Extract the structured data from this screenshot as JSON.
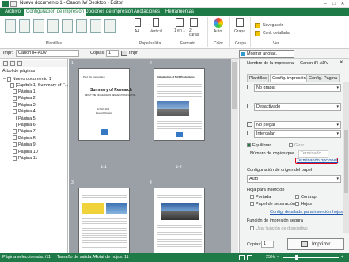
{
  "window": {
    "title": "Nuevo documento 1 - Canon iW Desktop - Editor"
  },
  "menu": {
    "tabs": [
      "Archivo",
      "Configuración de impresión",
      "Opciones de impresión",
      "Anotaciones",
      "Herramientas"
    ]
  },
  "ribbon": {
    "groups": [
      "Plantillas",
      "Papel salida",
      "Formato",
      "Color",
      "Grapa",
      "Ver"
    ],
    "items": {
      "paper": "A4",
      "orientation": "Vertical",
      "layout": "1 en 1",
      "duplex": "2 caras",
      "color": "Auto",
      "staple": "Grapa"
    },
    "view": {
      "navigation": "Navegación",
      "detailed": "Conf. detallada"
    }
  },
  "toolbar": {
    "printer_label": "Impr:",
    "printer": "Canon iR-ADV",
    "copies_label": "Copias:",
    "copies": "1",
    "print_btn": "Impr.",
    "show_annotations": "Mostrar anotac."
  },
  "tree": {
    "title": "Árbol de páginas",
    "root": "Nuevo documento 1",
    "chapter": "[Capítulo1] Summary of F...",
    "pages": [
      "Página 1",
      "Página 2",
      "Página 3",
      "Página 4",
      "Página 5",
      "Página 6",
      "Página 7",
      "Página 8",
      "Página 9",
      "Página 10",
      "Página 11"
    ]
  },
  "center": {
    "page_numbers": [
      "1",
      "2",
      "3",
      "4"
    ],
    "captions": [
      "1-1",
      "1-2"
    ],
    "thumb1": {
      "line1": "Pilot XG Corporation",
      "title": "Summary of Research",
      "sub": "ABOUT THE INFLUENCE OF RESEARCH AND CAPITAL",
      "date": "11 MAY, 2010",
      "author": "Research Division"
    },
    "thumb2": {
      "title": "Introduction of NAS Productions"
    }
  },
  "rightpane": {
    "printer_label": "Nombre de la impresora:",
    "printer": "Canon iR-ADV",
    "tabs": [
      "Plantillas",
      "Config. impresión",
      "Config. Página"
    ],
    "dropdowns": [
      "No grapar",
      "Desactivado",
      "No plegar",
      "Intercalar"
    ],
    "eco_label": "Equilibrar",
    "girar_label": "Girar",
    "copies_label": "Número de copias que",
    "copies_value": "Terminado",
    "finishing_link": "Terminando opciones",
    "origin_label": "Configuración de origen del papel",
    "origin_value": "Auto",
    "insert_label": "Hoja para inserción",
    "portada": "Portada",
    "contrap": "Contrap.",
    "papel_sep": "Papel de separación",
    "hojas": "Hojas",
    "insert_link": "Config. detallada para inserción hojas",
    "secure_label": "Función de impresión segura",
    "secure_check": "Usar función de dispositivo",
    "copies_bottom_label": "Copias:",
    "copies_bottom": "1",
    "print_button": "Imprimir"
  },
  "status": {
    "selected": "Página seleccionada: /11",
    "output": "Tamaño de salida:A4",
    "total": "Total de hojas: 11",
    "zoom": "25%"
  },
  "colors": {
    "brand": "#1e7b47",
    "highlight": "#e2001a"
  }
}
